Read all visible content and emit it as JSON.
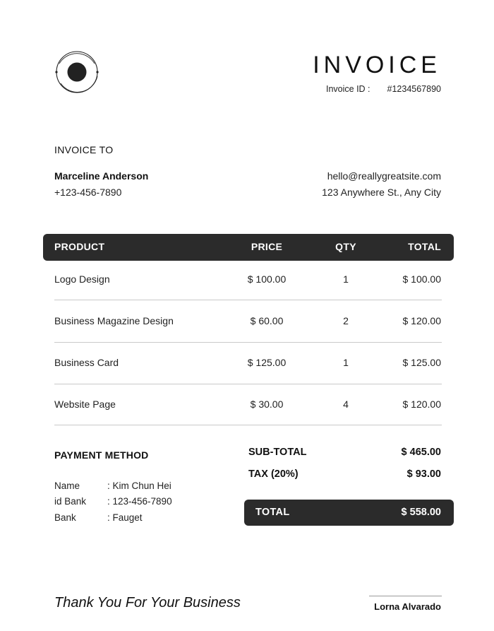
{
  "header": {
    "title": "INVOICE",
    "invoice_id_label": "Invoice ID :",
    "invoice_id_value": "#1234567890"
  },
  "billing": {
    "heading": "INVOICE TO",
    "name": "Marceline Anderson",
    "phone": "+123-456-7890",
    "email": "hello@reallygreatsite.com",
    "address": "123 Anywhere St., Any City"
  },
  "table": {
    "columns": [
      "PRODUCT",
      "PRICE",
      "QTY",
      "TOTAL"
    ],
    "rows": [
      {
        "product": "Logo Design",
        "price": "$ 100.00",
        "qty": "1",
        "total": "$ 100.00"
      },
      {
        "product": "Business Magazine Design",
        "price": "$ 60.00",
        "qty": "2",
        "total": "$ 120.00"
      },
      {
        "product": "Business Card",
        "price": "$ 125.00",
        "qty": "1",
        "total": "$ 125.00"
      },
      {
        "product": "Website Page",
        "price": "$ 30.00",
        "qty": "4",
        "total": "$ 120.00"
      }
    ]
  },
  "payment": {
    "heading": "PAYMENT METHOD",
    "fields": [
      {
        "label": "Name",
        "value": ": Kim Chun Hei"
      },
      {
        "label": "id Bank",
        "value": ": 123-456-7890"
      },
      {
        "label": "Bank",
        "value": ": Fauget"
      }
    ]
  },
  "summary": {
    "subtotal_label": "SUB-TOTAL",
    "subtotal_value": "$ 465.00",
    "tax_label": "TAX (20%)",
    "tax_value": "$ 93.00",
    "total_label": "TOTAL",
    "total_value": "$ 558.00"
  },
  "footer": {
    "thanks": "Thank You For Your Business",
    "signature_name": "Lorna Alvarado"
  },
  "colors": {
    "dark_bar": "#2b2b2b",
    "divider": "#c9c9c9"
  },
  "icons": {
    "logo": "orbit-logo-icon"
  }
}
